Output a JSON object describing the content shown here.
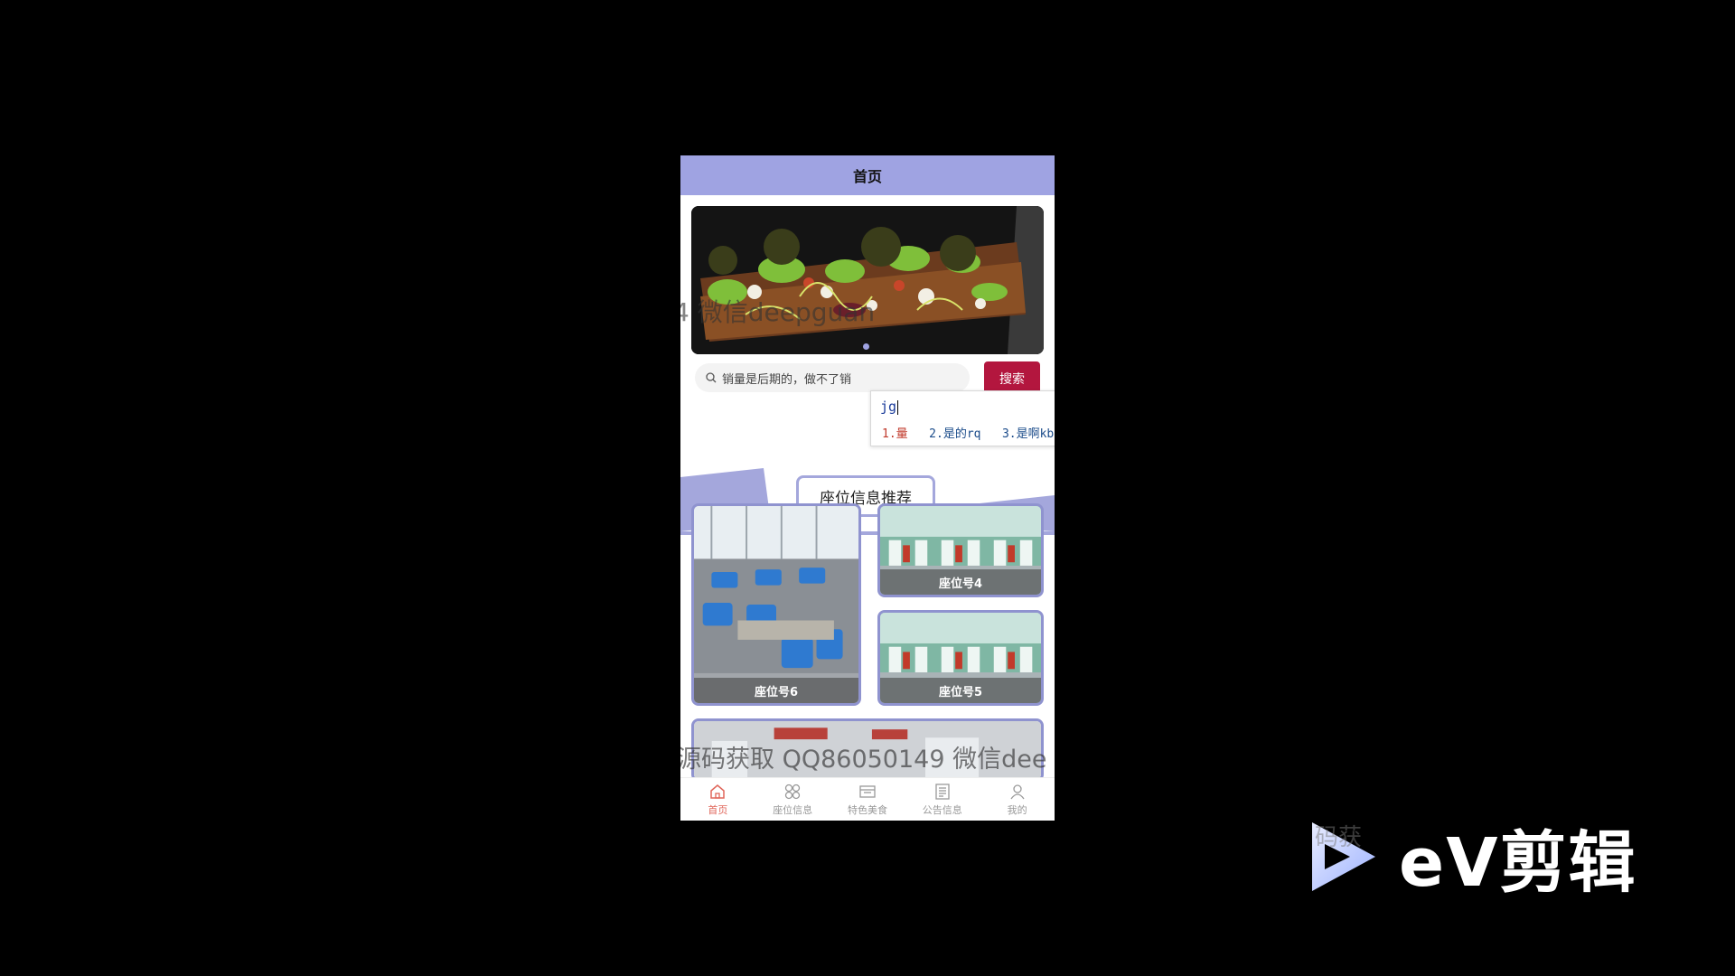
{
  "header": {
    "title": "首页"
  },
  "search": {
    "value": "销量是后期的，做不了销",
    "button_label": "搜索"
  },
  "ime": {
    "input": "jg",
    "candidates": [
      {
        "idx": "1.",
        "text": "量"
      },
      {
        "idx": "2.",
        "text": "是的rq"
      },
      {
        "idx": "3.",
        "text": "是啊kb"
      }
    ]
  },
  "section": {
    "title": "座位信息推荐"
  },
  "seats": [
    {
      "label": "座位号6"
    },
    {
      "label": "座位号4"
    },
    {
      "label": "座位号5"
    }
  ],
  "watermarks": {
    "top": "4 微信deepguan",
    "bottom": "源码获取 QQ86050149 微信dee",
    "corner": "码获"
  },
  "tabbar": [
    {
      "label": "首页",
      "icon": "home-icon",
      "active": true
    },
    {
      "label": "座位信息",
      "icon": "seats-icon",
      "active": false
    },
    {
      "label": "特色美食",
      "icon": "food-icon",
      "active": false
    },
    {
      "label": "公告信息",
      "icon": "notice-icon",
      "active": false
    },
    {
      "label": "我的",
      "icon": "user-icon",
      "active": false
    }
  ],
  "branding": {
    "text": "eV剪辑"
  },
  "colors": {
    "accent": "#9fa3e2",
    "search_button": "#b3163e",
    "active_tab": "#e0665a"
  }
}
